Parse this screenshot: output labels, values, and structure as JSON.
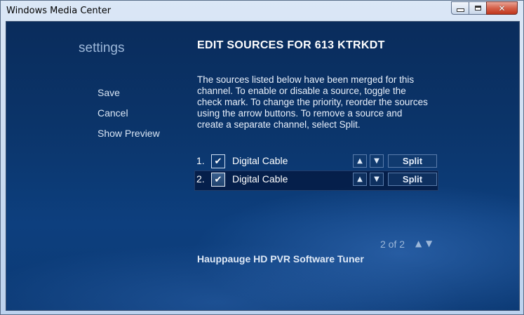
{
  "window": {
    "title": "Windows Media Center",
    "minimize_glyph": "minimize-icon",
    "maximize_glyph": "maximize-icon",
    "close_glyph": "✕"
  },
  "sidebar": {
    "heading": "settings",
    "items": [
      {
        "label": "Save"
      },
      {
        "label": "Cancel"
      },
      {
        "label": "Show Preview"
      }
    ]
  },
  "main": {
    "title": "EDIT SOURCES FOR 613 KTRKDT",
    "instructions": "The sources listed below have been merged for this channel. To enable or disable a source, toggle the check mark. To change the priority, reorder the sources using the arrow buttons. To remove a source and create a separate channel, select Split.",
    "sources": [
      {
        "number": "1.",
        "name": "Digital Cable",
        "checked": "✔",
        "up": "▲",
        "down": "▼",
        "split_label": "Split"
      },
      {
        "number": "2.",
        "name": "Digital Cable",
        "checked": "✔",
        "up": "▲",
        "down": "▼",
        "split_label": "Split"
      }
    ],
    "pager": {
      "text": "2 of 2",
      "up": "▲",
      "down": "▼"
    },
    "tuner": "Hauppauge HD PVR Software Tuner"
  },
  "colors": {
    "background": "#0b3469",
    "text": "#ffffff",
    "muted_text": "#9db8d9"
  }
}
